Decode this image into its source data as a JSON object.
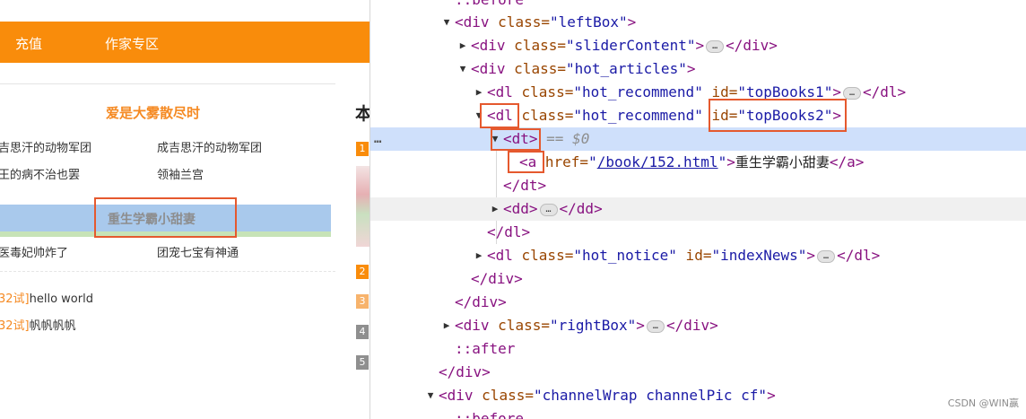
{
  "page": {
    "nav": {
      "links": [
        "充值",
        "作家专区"
      ]
    },
    "book_title": "爱是大雾散尽时",
    "rows": [
      [
        "吉思汗的动物军团",
        "成吉思汗的动物军团"
      ],
      [
        "王的病不治也罢",
        "领袖兰宫"
      ]
    ],
    "highlight_title": "重生学霸小甜妻",
    "rows2": [
      [
        "医毒妃帅炸了",
        "团宠七宝有神通"
      ]
    ],
    "notices": [
      {
        "tag": "32试]",
        "text": "hello world"
      },
      {
        "tag": "32试]",
        "text": "帆帆帆帆"
      }
    ],
    "right_col_head": "本",
    "ranks": [
      "1",
      "2",
      "3",
      "4",
      "5"
    ]
  },
  "devtools": {
    "lines": {
      "l0": "::before",
      "l1_tag": "<div ",
      "l1_attr": "class=",
      "l1_val": "\"leftBox\"",
      "l1_end": ">",
      "l2_tag": "<div ",
      "l2_attr": "class=",
      "l2_val": "\"sliderContent\"",
      "l2_end": ">",
      "l2_close": "</div>",
      "l3_tag": "<div ",
      "l3_attr": "class=",
      "l3_val": "\"hot_articles\"",
      "l3_end": ">",
      "l4_tag": "<dl ",
      "l4_attr": "class=",
      "l4_val": "\"hot_recommend\"",
      "l4_attr2": " id=",
      "l4_val2": "\"topBooks1\"",
      "l4_end": ">",
      "l4_close": "</dl>",
      "l5_tag": "<dl",
      "l5_attr": " class=",
      "l5_val": "\"hot_recommend\"",
      "l5_attr2": " id=",
      "l5_val2": "\"topBooks2\"",
      "l5_end": ">",
      "l6_tag": "<dt>",
      "l6_eq": "== $0",
      "l7_tag": "<a",
      "l7_attr": " href=",
      "l7_link": "/book/152.html",
      "l7_text": "重生学霸小甜妻",
      "l7_close": "</a>",
      "l8": "</dt>",
      "l9_tag": "<dd>",
      "l9_close": "</dd>",
      "l10": "</dl>",
      "l11_tag": "<dl ",
      "l11_attr": "class=",
      "l11_val": "\"hot_notice\"",
      "l11_attr2": " id=",
      "l11_val2": "\"indexNews\"",
      "l11_end": ">",
      "l11_close": "</dl>",
      "l12": "</div>",
      "l13": "</div>",
      "l14_tag": "<div ",
      "l14_attr": "class=",
      "l14_val": "\"rightBox\"",
      "l14_end": ">",
      "l14_close": "</div>",
      "l15": "::after",
      "l16": "</div>",
      "l17_tag": "<div ",
      "l17_attr": "class=",
      "l17_val": "\"channelWrap channelPic cf\"",
      "l17_end": ">",
      "l18": "::before"
    },
    "ellipsis": "…",
    "row_dots": "…"
  },
  "watermark": "CSDN @WIN赢"
}
